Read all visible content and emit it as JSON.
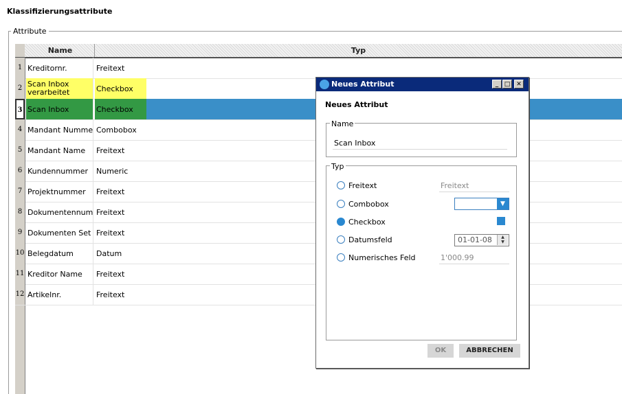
{
  "page": {
    "title": "Klassifizierungsattribute",
    "group_label": "Attribute"
  },
  "table": {
    "columns": [
      "Name",
      "Typ"
    ],
    "rows": [
      {
        "num": "1",
        "name": "Kreditornr.",
        "type": "Freitext"
      },
      {
        "num": "2",
        "name": "Scan Inbox verarbeitet",
        "type": "Checkbox"
      },
      {
        "num": "3",
        "name": "Scan Inbox",
        "type": "Checkbox"
      },
      {
        "num": "4",
        "name": "Mandant Nummer",
        "type": "Combobox"
      },
      {
        "num": "5",
        "name": "Mandant Name",
        "type": "Freitext"
      },
      {
        "num": "6",
        "name": "Kundennummer",
        "type": "Numeric"
      },
      {
        "num": "7",
        "name": "Projektnummer",
        "type": "Freitext"
      },
      {
        "num": "8",
        "name": "Dokumentennum...",
        "type": "Freitext"
      },
      {
        "num": "9",
        "name": "Dokumenten Set ID",
        "type": "Freitext"
      },
      {
        "num": "10",
        "name": "Belegdatum",
        "type": "Datum"
      },
      {
        "num": "11",
        "name": "Kreditor Name",
        "type": "Freitext"
      },
      {
        "num": "12",
        "name": "Artikelnr.",
        "type": "Freitext"
      }
    ]
  },
  "dialog": {
    "window_title": "Neues Attribut",
    "header": "Neues Attribut",
    "name_group": {
      "label": "Name",
      "value": "Scan Inbox"
    },
    "type_group": {
      "label": "Typ",
      "options": [
        {
          "label": "Freitext",
          "preview": "Freitext",
          "selected": false
        },
        {
          "label": "Combobox",
          "preview": "",
          "selected": false
        },
        {
          "label": "Checkbox",
          "preview": "",
          "selected": true
        },
        {
          "label": "Datumsfeld",
          "preview": "01-01-08",
          "selected": false
        },
        {
          "label": "Numerisches Feld",
          "preview": "1'000.99",
          "selected": false
        }
      ]
    },
    "buttons": {
      "ok": "OK",
      "cancel": "ABBRECHEN"
    }
  },
  "colors": {
    "title_bar": "#0a2a7a",
    "selection": "#3a8fc8",
    "highlight_yellow": "#ffff66",
    "highlight_green": "#339944",
    "accent": "#2a88d0"
  },
  "icons": {
    "title_bar": "app-logo-icon",
    "minimize": "minimize-icon",
    "maximize": "maximize-icon",
    "close": "close-icon"
  }
}
